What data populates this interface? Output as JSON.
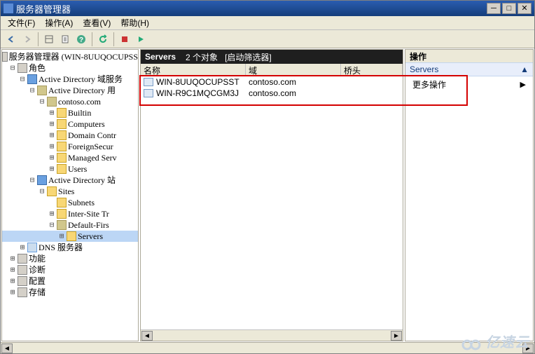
{
  "window": {
    "title": "服务器管理器"
  },
  "menubar": {
    "file": "文件(F)",
    "action": "操作(A)",
    "view": "查看(V)",
    "help": "帮助(H)"
  },
  "tree": {
    "root": "服务器管理器 (WIN-8UUQOCUPSS",
    "roles": "角色",
    "ad_domain_services": "Active Directory 域服务",
    "ad_users": "Active Directory 用",
    "domain": "contoso.com",
    "builtin": "Builtin",
    "computers": "Computers",
    "domain_contr": "Domain Contr",
    "foreign": "ForeignSecur",
    "managed": "Managed Serv",
    "users": "Users",
    "ad_sites": "Active Directory 站",
    "sites": "Sites",
    "subnets": "Subnets",
    "intersite": "Inter-Site Tr",
    "default_first": "Default-Firs",
    "servers": "Servers",
    "dns": "DNS 服务器",
    "features": "功能",
    "diagnostics": "诊断",
    "config": "配置",
    "storage": "存储"
  },
  "mid": {
    "title": "Servers",
    "count": "2 个对象",
    "filter": "[启动筛选器]",
    "cols": {
      "name": "名称",
      "domain": "域",
      "bridge": "桥头"
    },
    "rows": [
      {
        "name": "WIN-8UUQOCUPSST",
        "domain": "contoso.com"
      },
      {
        "name": "WIN-R9C1MQCGM3J",
        "domain": "contoso.com"
      }
    ]
  },
  "right": {
    "head": "操作",
    "sub": "Servers",
    "more": "更多操作"
  },
  "watermark": "亿速云"
}
